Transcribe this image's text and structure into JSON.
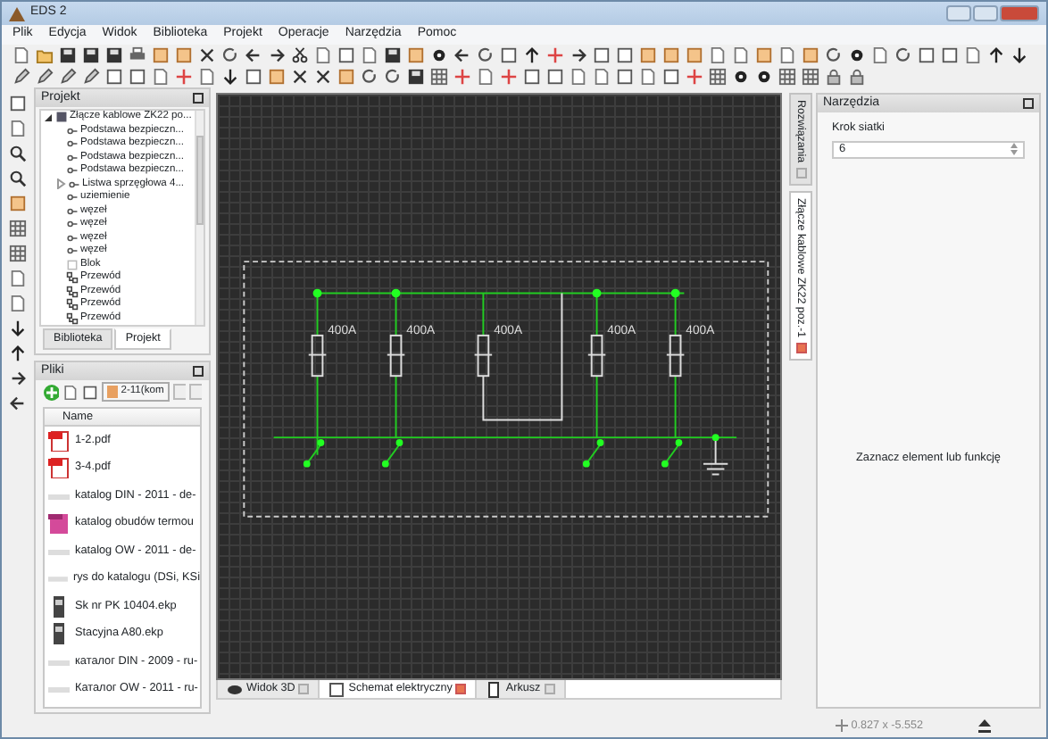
{
  "window": {
    "title": "EDS 2"
  },
  "menu": [
    "Plik",
    "Edycja",
    "Widok",
    "Biblioteka",
    "Projekt",
    "Operacje",
    "Narzędzia",
    "Pomoc"
  ],
  "project_panel": {
    "title": "Projekt",
    "tree": [
      {
        "label": "Złącze kablowe ZK22 po...",
        "kind": "project",
        "expanded": true,
        "children": [
          {
            "label": "Podstawa bezpieczn...",
            "kind": "node"
          },
          {
            "label": "Podstawa bezpieczn...",
            "kind": "node"
          },
          {
            "label": "Podstawa bezpieczn...",
            "kind": "node"
          },
          {
            "label": "Podstawa bezpieczn...",
            "kind": "node"
          },
          {
            "label": "Listwa sprzęgłowa 4...",
            "kind": "node",
            "expanded": false
          },
          {
            "label": "uziemienie",
            "kind": "node"
          },
          {
            "label": "węzeł",
            "kind": "node"
          },
          {
            "label": "węzeł",
            "kind": "node"
          },
          {
            "label": "węzeł",
            "kind": "node"
          },
          {
            "label": "węzeł",
            "kind": "node"
          },
          {
            "label": "Blok",
            "kind": "block"
          },
          {
            "label": "Przewód",
            "kind": "wire"
          },
          {
            "label": "Przewód",
            "kind": "wire"
          },
          {
            "label": "Przewód",
            "kind": "wire"
          },
          {
            "label": "Przewód",
            "kind": "wire"
          }
        ]
      }
    ],
    "tabs": [
      {
        "label": "Biblioteka",
        "selected": false
      },
      {
        "label": "Projekt",
        "selected": true
      }
    ]
  },
  "files_panel": {
    "title": "Pliki",
    "path": "2-11(kom",
    "column": "Name",
    "files": [
      {
        "name": "1-2.pdf",
        "kind": "pdf"
      },
      {
        "name": "3-4.pdf",
        "kind": "pdf"
      },
      {
        "name": "katalog DIN - 2011 - de-",
        "kind": "thumb"
      },
      {
        "name": "katalog obudów termou",
        "kind": "document"
      },
      {
        "name": "katalog OW - 2011 - de-",
        "kind": "thumb"
      },
      {
        "name": "rys do katalogu (DSi, KSi",
        "kind": "thumb"
      },
      {
        "name": "Sk nr PK 10404.ekp",
        "kind": "device"
      },
      {
        "name": "Stacyjna A80.ekp",
        "kind": "device"
      },
      {
        "name": "каталог DIN - 2009 - ru-",
        "kind": "thumb"
      },
      {
        "name": "Каталог OW - 2011 - ru-",
        "kind": "thumb"
      }
    ]
  },
  "canvas": {
    "fuse_ratings": [
      "400A",
      "400A",
      "400A",
      "400A",
      "400A"
    ],
    "tabs": [
      {
        "label": "Widok 3D",
        "selected": false
      },
      {
        "label": "Schemat elektryczny",
        "selected": true
      },
      {
        "label": "Arkusz",
        "selected": false
      }
    ]
  },
  "side_tabs": [
    {
      "label": "Rozwiązania",
      "selected": false
    },
    {
      "label": "Złącze kablowe ZK22 poz.-1",
      "selected": true
    }
  ],
  "tools_panel": {
    "title": "Narzędzia",
    "grid_step_label": "Krok siatki",
    "grid_step": "6",
    "hint": "Zaznacz element lub funkcję"
  },
  "status_bar": {
    "coordinates": "0.827 x -5.552"
  }
}
